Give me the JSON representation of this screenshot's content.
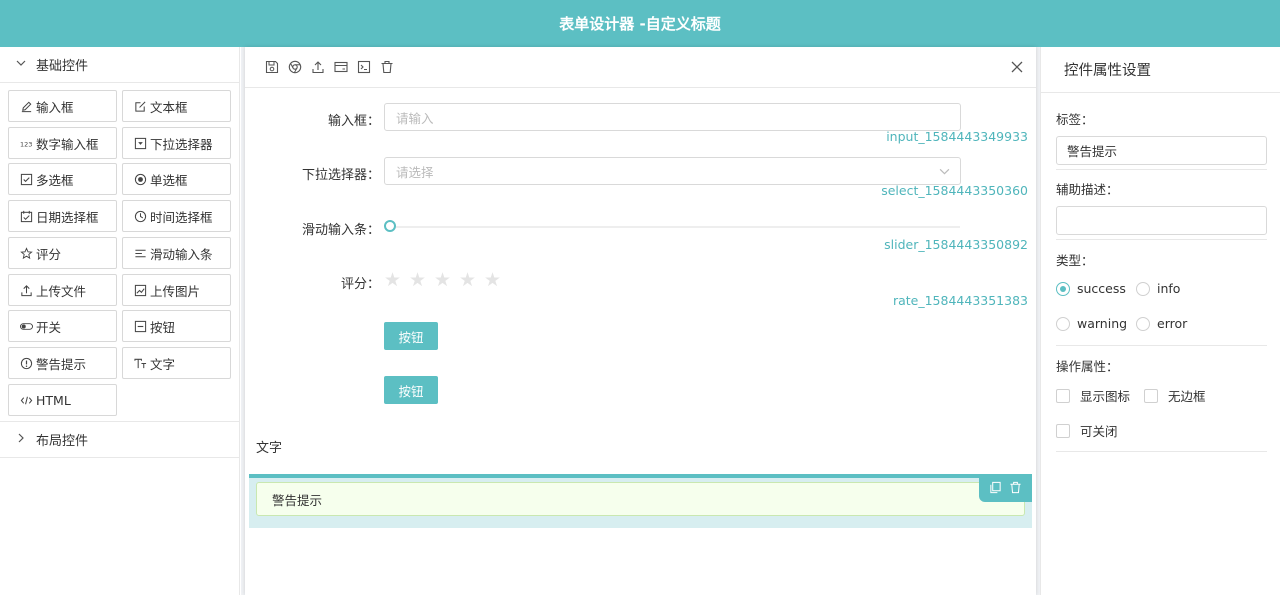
{
  "header": {
    "title": "表单设计器 -自定义标题"
  },
  "sidebar": {
    "basic_group": "基础控件",
    "layout_group": "布局控件",
    "controls": [
      {
        "label": "输入框",
        "icon": "edit-icon"
      },
      {
        "label": "文本框",
        "icon": "form-icon"
      },
      {
        "label": "数字输入框",
        "icon": "number-icon"
      },
      {
        "label": "下拉选择器",
        "icon": "dropdown-icon"
      },
      {
        "label": "多选框",
        "icon": "checkbox-icon"
      },
      {
        "label": "单选框",
        "icon": "radio-icon"
      },
      {
        "label": "日期选择框",
        "icon": "calendar-icon"
      },
      {
        "label": "时间选择框",
        "icon": "clock-icon"
      },
      {
        "label": "评分",
        "icon": "star-icon"
      },
      {
        "label": "滑动输入条",
        "icon": "slider-icon"
      },
      {
        "label": "上传文件",
        "icon": "upload-icon"
      },
      {
        "label": "上传图片",
        "icon": "image-icon"
      },
      {
        "label": "开关",
        "icon": "switch-icon"
      },
      {
        "label": "按钮",
        "icon": "minus-square-icon"
      },
      {
        "label": "警告提示",
        "icon": "alert-icon"
      },
      {
        "label": "文字",
        "icon": "text-icon"
      },
      {
        "label": "HTML",
        "icon": "code-icon"
      }
    ]
  },
  "toolbar": {
    "icons": [
      "save-icon",
      "chrome-icon",
      "upload-icon",
      "credit-card-icon",
      "terminal-icon",
      "delete-icon"
    ]
  },
  "form": {
    "input": {
      "label": "输入框：",
      "placeholder": "请输入",
      "id": "input_1584443349933"
    },
    "select": {
      "label": "下拉选择器：",
      "placeholder": "请选择",
      "id": "select_1584443350360"
    },
    "slider": {
      "label": "滑动输入条：",
      "value": 0,
      "id": "slider_1584443350892"
    },
    "rate": {
      "label": "评分：",
      "value": 0,
      "max": 5,
      "id": "rate_1584443351383"
    },
    "button1": "按钮",
    "button2": "按钮",
    "text": "文字",
    "alert": "警告提示"
  },
  "props": {
    "title": "控件属性设置",
    "label_title": "标签：",
    "label_value": "警告提示",
    "desc_title": "辅助描述：",
    "desc_value": "",
    "type_title": "类型：",
    "types": [
      "success",
      "info",
      "warning",
      "error"
    ],
    "selected_type": "success",
    "ops_title": "操作属性：",
    "ops": [
      "显示图标",
      "无边框",
      "可关闭"
    ]
  },
  "colors": {
    "accent": "#5cbfc3",
    "alert_bg": "#f6ffed"
  }
}
